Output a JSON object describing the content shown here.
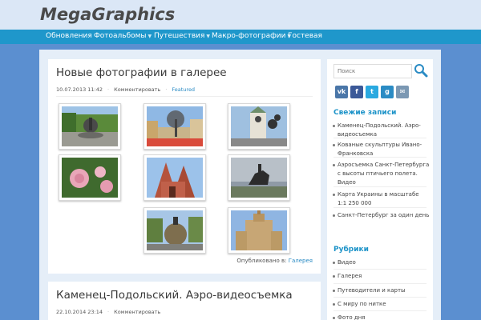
{
  "site": {
    "title": "MegaGraphics"
  },
  "nav": {
    "items": [
      {
        "label": "Обновления",
        "has_submenu": false
      },
      {
        "label": "Фотоальбомы",
        "has_submenu": true
      },
      {
        "label": "Путешествия",
        "has_submenu": true
      },
      {
        "label": "Макро-фотографии",
        "has_submenu": true
      },
      {
        "label": "Гостевая",
        "has_submenu": false
      }
    ]
  },
  "posts": [
    {
      "title": "Новые фотографии в галерее",
      "date": "10.07.2013 11:42",
      "comment_label": "Комментировать",
      "category_tag": "Featured",
      "published_label": "Опубликовано в:",
      "published_category": "Галерея",
      "thumbnails": [
        "fountain-photo",
        "sculpture-tree-photo",
        "clock-tower-photo",
        "stadium-photo",
        "roses-photo",
        "cathedral-photo",
        "horseman-statue-photo",
        "globe-monument-photo",
        "highrise-building-photo",
        "chapel-photo"
      ]
    },
    {
      "title": "Каменец-Подольский. Аэро-видеосъемка",
      "date": "22.10.2014 23:14",
      "comment_label": "Комментировать"
    }
  ],
  "sidebar": {
    "search_placeholder": "Поиск",
    "social": [
      {
        "icon": "vk-icon",
        "color": "#4a76a8",
        "glyph": "vk"
      },
      {
        "icon": "facebook-icon",
        "color": "#3b5998",
        "glyph": "f"
      },
      {
        "icon": "twitter-icon",
        "color": "#2aa9e0",
        "glyph": "t"
      },
      {
        "icon": "google-plus-icon",
        "color": "#2a8bc4",
        "glyph": "g"
      },
      {
        "icon": "mail-icon",
        "color": "#7b98b3",
        "glyph": "✉"
      }
    ],
    "recent": {
      "title": "Свежие записи",
      "items": [
        "Каменец-Подольский. Аэро-видеосъемка",
        "Кованые скульптуры Ивано-Франковска",
        "Аэросъемка Санкт-Петербурга с высоты птичьего полета. Видео",
        "Карта Украины в масштабе 1:1 250 000",
        "Санкт-Петербург за один день"
      ]
    },
    "rubrics": {
      "title": "Рубрики",
      "items": [
        "Видео",
        "Галерея",
        "Путеводители и карты",
        "С миру по нитке",
        "Фото дня"
      ]
    }
  },
  "colors": {
    "accent": "#1f97cb",
    "page_bg": "#5b8fd0",
    "header_bg": "#dbe7f6",
    "link": "#2a8bc4"
  }
}
